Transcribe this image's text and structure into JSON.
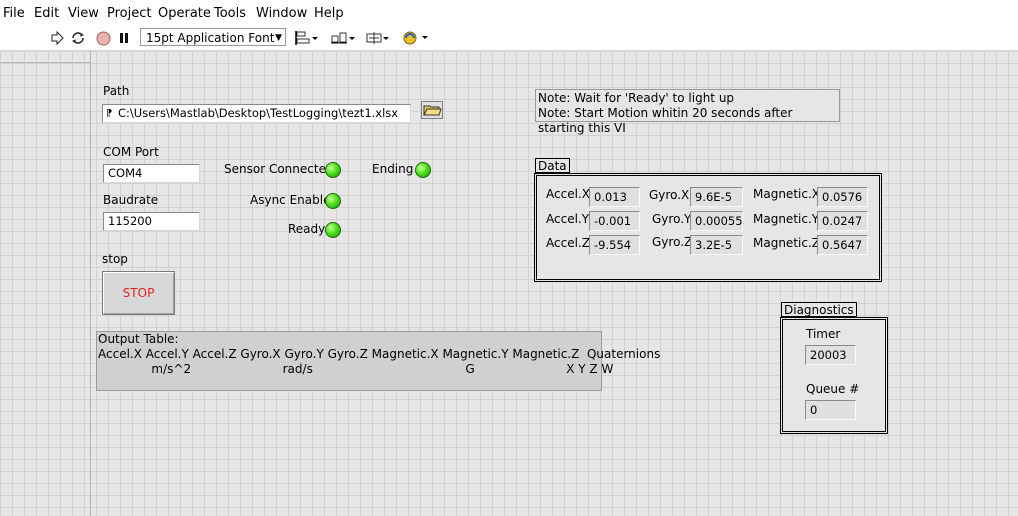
{
  "menu": [
    "File",
    "Edit",
    "View",
    "Project",
    "Operate",
    "Tools",
    "Window",
    "Help"
  ],
  "toolbar": {
    "font_select": "15pt Application Font",
    "icons": [
      "run-arrow-icon",
      "run-continuous-icon",
      "abort-icon",
      "pause-icon",
      "align-icon",
      "distribute-icon",
      "resize-icon",
      "reorder-icon"
    ]
  },
  "path": {
    "label": "Path",
    "value": "C:\\Users\\Mastlab\\Desktop\\TestLogging\\tezt1.xlsx"
  },
  "com_port": {
    "label": "COM Port",
    "value": "COM4"
  },
  "baudrate": {
    "label": "Baudrate",
    "value": "115200"
  },
  "stop": {
    "label": "stop",
    "button": "STOP"
  },
  "leds": {
    "sensor_connected": "Sensor Connected",
    "async_enable": "Async Enable",
    "ready": "Ready",
    "ending": "Ending",
    "color": "#4fe21b"
  },
  "note": {
    "line1": "Note: Wait for 'Ready' to light up",
    "line2": "Note: Start Motion whitin 20 seconds after starting this VI"
  },
  "data": {
    "label": "Data",
    "accel_x": {
      "label": "Accel.X",
      "value": "0.013"
    },
    "accel_y": {
      "label": "Accel.Y",
      "value": "-0.001"
    },
    "accel_z": {
      "label": "Accel.Z",
      "value": "-9.554"
    },
    "gyro_x": {
      "label": "Gyro.X",
      "value": "9.6E-5"
    },
    "gyro_y": {
      "label": "Gyro.Y",
      "value": "0.000552"
    },
    "gyro_z": {
      "label": "Gyro.Z",
      "value": "3.2E-5"
    },
    "mag_x": {
      "label": "Magnetic.X",
      "value": "0.0576"
    },
    "mag_y": {
      "label": "Magnetic.Y",
      "value": "0.0247"
    },
    "mag_z": {
      "label": "Magnetic.Z",
      "value": "0.5647"
    }
  },
  "output_table": {
    "line1": "Output Table:",
    "line2": "Accel.X Accel.Y Accel.Z Gyro.X Gyro.Y Gyro.Z Magnetic.X Magnetic.Y Magnetic.Z  Quaternions",
    "line3": "              m/s^2                        rad/s                                        G                        X Y Z W"
  },
  "diagnostics": {
    "label": "Diagnostics",
    "timer_label": "Timer",
    "timer_value": "20003",
    "queue_label": "Queue #",
    "queue_value": "0"
  }
}
